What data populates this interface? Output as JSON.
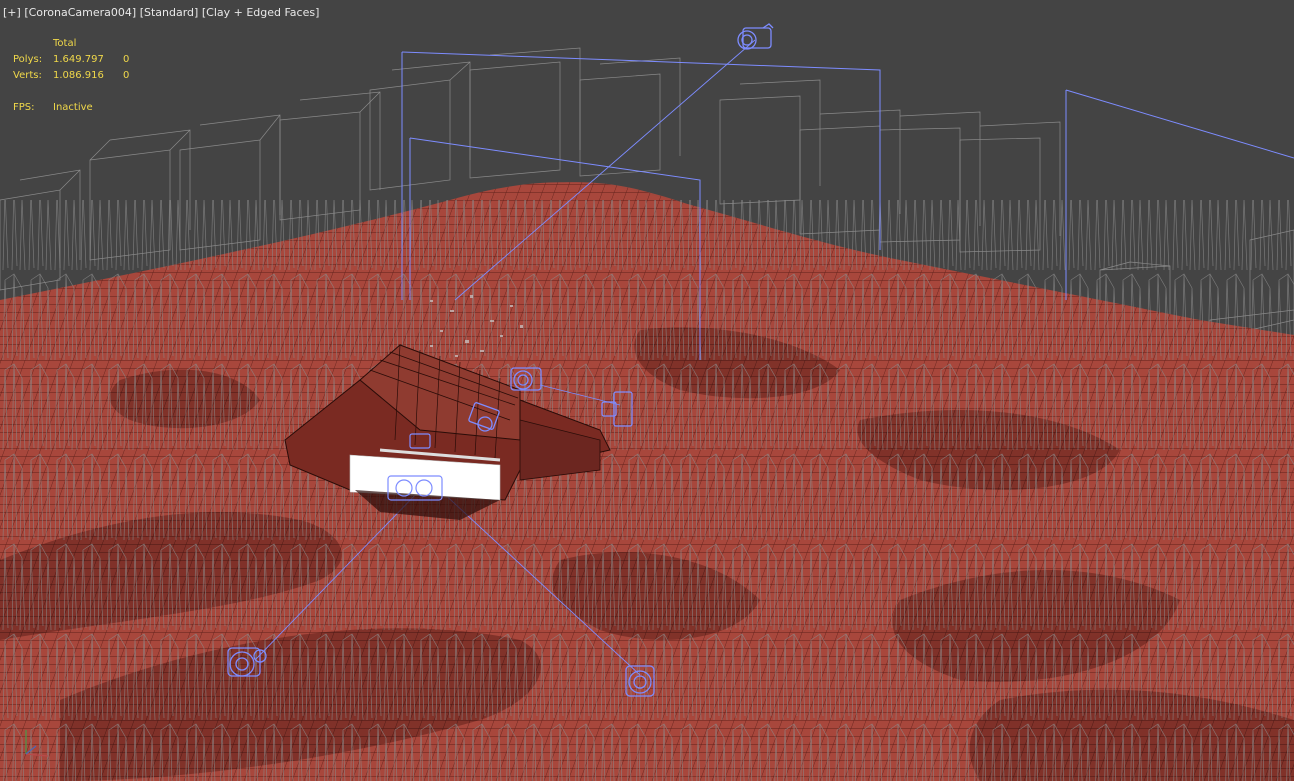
{
  "viewport": {
    "label_plus": "[+]",
    "label_camera": "[CoronaCamera004]",
    "label_mode": "[Standard]",
    "label_shading": "[Clay + Edged Faces]"
  },
  "stats": {
    "header": "Total",
    "polys_label": "Polys:",
    "polys_value": "1.649.797",
    "polys_sel": "0",
    "verts_label": "Verts:",
    "verts_value": "1.086.916",
    "verts_sel": "0",
    "fps_label": "FPS:",
    "fps_value": "Inactive"
  },
  "colors": {
    "background": "#444444",
    "terrain": "#a8473c",
    "terrain_shadow": "#6e2820",
    "wire": "#8a8a8a",
    "camera": "#7d8cff",
    "stats": "#f0d84a"
  },
  "icons": {
    "camera": "camera-icon",
    "axis": "axis-gizmo-icon"
  }
}
